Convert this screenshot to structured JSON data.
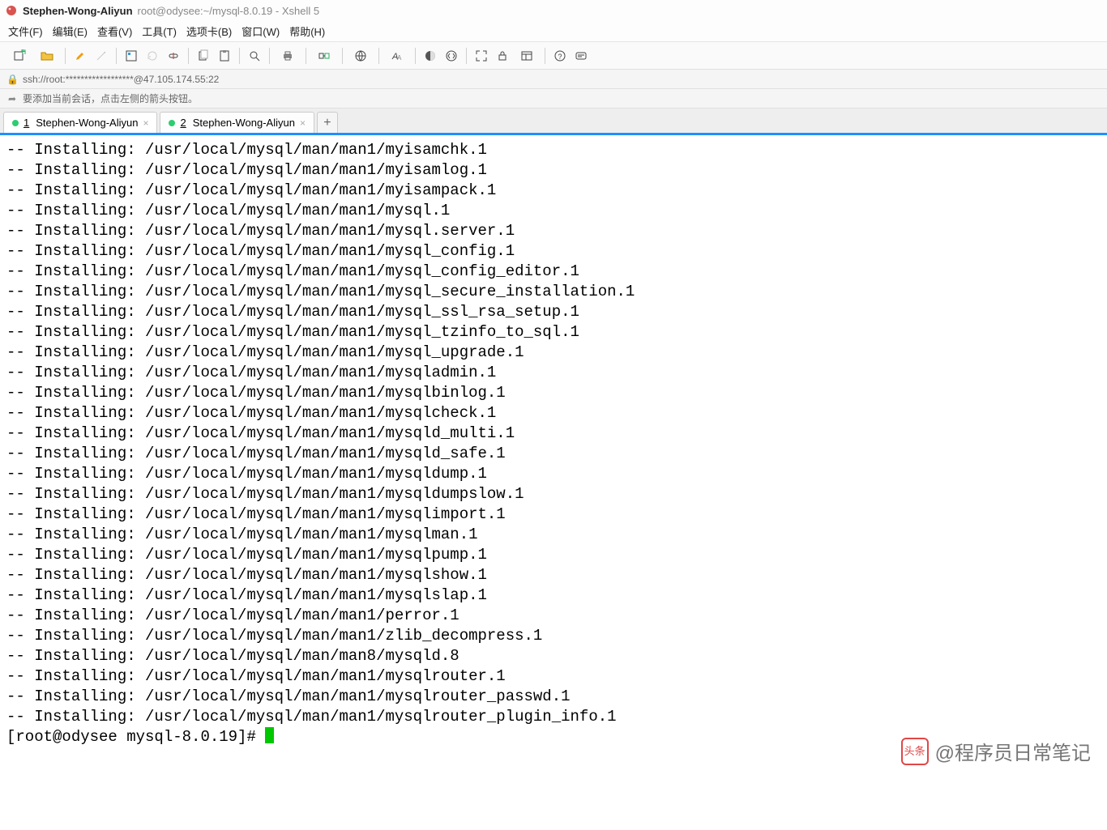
{
  "title": {
    "session": "Stephen-Wong-Aliyun",
    "subtitle": "root@odysee:~/mysql-8.0.19 - Xshell 5"
  },
  "menu": {
    "file": "文件(F)",
    "edit": "编辑(E)",
    "view": "查看(V)",
    "tools": "工具(T)",
    "tabs": "选项卡(B)",
    "window": "窗口(W)",
    "help": "帮助(H)"
  },
  "address": {
    "url": "ssh://root:******************@47.105.174.55:22"
  },
  "infobar": {
    "hint": "要添加当前会话，点击左侧的箭头按钮。"
  },
  "tabs": {
    "t1": {
      "num": "1",
      "label": "Stephen-Wong-Aliyun"
    },
    "t2": {
      "num": "2",
      "label": "Stephen-Wong-Aliyun"
    },
    "add": "+"
  },
  "terminal": {
    "lines": [
      "-- Installing: /usr/local/mysql/man/man1/myisamchk.1",
      "-- Installing: /usr/local/mysql/man/man1/myisamlog.1",
      "-- Installing: /usr/local/mysql/man/man1/myisampack.1",
      "-- Installing: /usr/local/mysql/man/man1/mysql.1",
      "-- Installing: /usr/local/mysql/man/man1/mysql.server.1",
      "-- Installing: /usr/local/mysql/man/man1/mysql_config.1",
      "-- Installing: /usr/local/mysql/man/man1/mysql_config_editor.1",
      "-- Installing: /usr/local/mysql/man/man1/mysql_secure_installation.1",
      "-- Installing: /usr/local/mysql/man/man1/mysql_ssl_rsa_setup.1",
      "-- Installing: /usr/local/mysql/man/man1/mysql_tzinfo_to_sql.1",
      "-- Installing: /usr/local/mysql/man/man1/mysql_upgrade.1",
      "-- Installing: /usr/local/mysql/man/man1/mysqladmin.1",
      "-- Installing: /usr/local/mysql/man/man1/mysqlbinlog.1",
      "-- Installing: /usr/local/mysql/man/man1/mysqlcheck.1",
      "-- Installing: /usr/local/mysql/man/man1/mysqld_multi.1",
      "-- Installing: /usr/local/mysql/man/man1/mysqld_safe.1",
      "-- Installing: /usr/local/mysql/man/man1/mysqldump.1",
      "-- Installing: /usr/local/mysql/man/man1/mysqldumpslow.1",
      "-- Installing: /usr/local/mysql/man/man1/mysqlimport.1",
      "-- Installing: /usr/local/mysql/man/man1/mysqlman.1",
      "-- Installing: /usr/local/mysql/man/man1/mysqlpump.1",
      "-- Installing: /usr/local/mysql/man/man1/mysqlshow.1",
      "-- Installing: /usr/local/mysql/man/man1/mysqlslap.1",
      "-- Installing: /usr/local/mysql/man/man1/perror.1",
      "-- Installing: /usr/local/mysql/man/man1/zlib_decompress.1",
      "-- Installing: /usr/local/mysql/man/man8/mysqld.8",
      "-- Installing: /usr/local/mysql/man/man1/mysqlrouter.1",
      "-- Installing: /usr/local/mysql/man/man1/mysqlrouter_passwd.1",
      "-- Installing: /usr/local/mysql/man/man1/mysqlrouter_plugin_info.1"
    ],
    "prompt": "[root@odysee mysql-8.0.19]# "
  },
  "watermark": {
    "brand": "头条",
    "text": "@程序员日常笔记"
  }
}
